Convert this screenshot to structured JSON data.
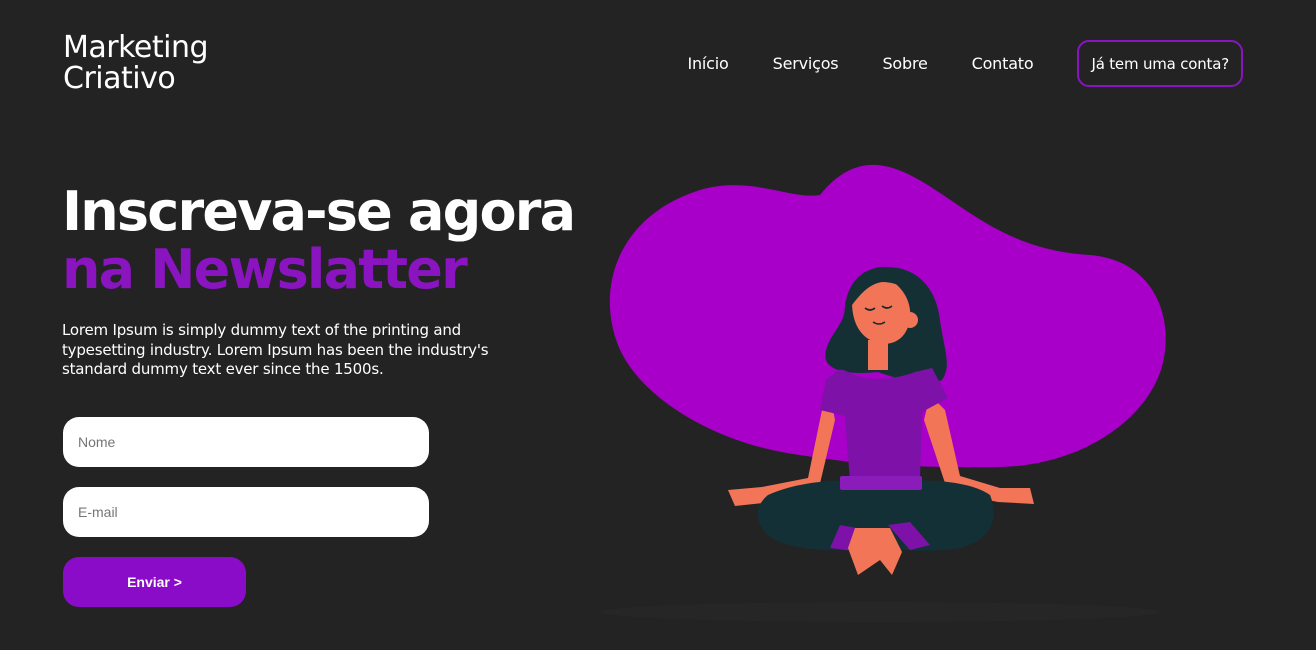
{
  "brand": {
    "line1": "Marketing",
    "line2": "Criativo"
  },
  "nav": {
    "items": [
      "Início",
      "Serviços",
      "Sobre",
      "Contato"
    ],
    "account_button": "Já tem uma conta?"
  },
  "hero": {
    "title_line1": "Inscreva-se agora",
    "title_line2": "na Newslatter",
    "description": "Lorem Ipsum is simply dummy text of the printing and typesetting industry. Lorem Ipsum has been the industry's standard dummy text ever since the 1500s."
  },
  "form": {
    "name_placeholder": "Nome",
    "email_placeholder": "E-mail",
    "submit_label": "Enviar >"
  },
  "colors": {
    "background": "#232323",
    "accent": "#8a14c0",
    "blob": "#a800c8"
  },
  "illustration": {
    "icon": "meditating-woman-illustration"
  }
}
